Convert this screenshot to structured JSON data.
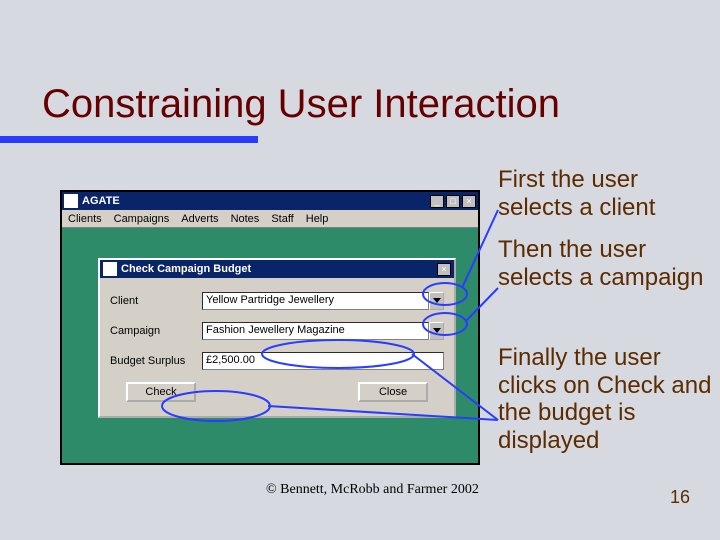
{
  "title": "Constraining User Interaction",
  "captions": {
    "c1": "First the user selects a client",
    "c2": "Then the user selects a campaign",
    "c3": "Finally the user clicks on Check and the budget is displayed"
  },
  "app": {
    "title": "AGATE",
    "menu": [
      "Clients",
      "Campaigns",
      "Adverts",
      "Notes",
      "Staff",
      "Help"
    ]
  },
  "dialog": {
    "title": "Check Campaign Budget",
    "labels": {
      "client": "Client",
      "campaign": "Campaign",
      "budget": "Budget Surplus"
    },
    "values": {
      "client": "Yellow Partridge Jewellery",
      "campaign": "Fashion Jewellery Magazine",
      "budget": "£2,500.00"
    },
    "buttons": {
      "check": "Check",
      "close": "Close"
    }
  },
  "footer": "© Bennett, McRobb and Farmer 2002",
  "page": "16"
}
